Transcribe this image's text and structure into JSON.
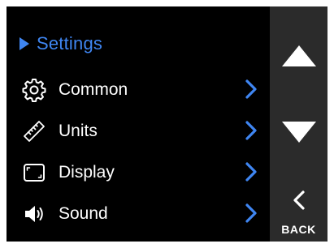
{
  "header": {
    "title": "Settings"
  },
  "menu": {
    "items": [
      {
        "label": "Common",
        "icon": "gear-icon"
      },
      {
        "label": "Units",
        "icon": "ruler-icon"
      },
      {
        "label": "Display",
        "icon": "display-icon"
      },
      {
        "label": "Sound",
        "icon": "speaker-icon"
      }
    ]
  },
  "side": {
    "up_icon": "triangle-up-icon",
    "down_icon": "triangle-down-icon",
    "back_icon": "chevron-left-icon",
    "back_label": "BACK"
  },
  "colors": {
    "accent": "#3f86f2",
    "background": "#000000",
    "side_panel": "#2b2b2b",
    "text": "#ffffff"
  }
}
